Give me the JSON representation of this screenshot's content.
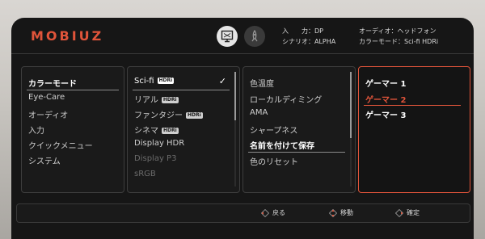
{
  "header": {
    "logo": "MOBIUZ",
    "info": {
      "input_label": "入　　力：",
      "input_value": "DP",
      "scenario_label": "シナリオ：",
      "scenario_value": "ALPHA",
      "audio_label": "オーディオ：",
      "audio_value": "ヘッドフォン",
      "color_mode_label": "カラーモード：",
      "color_mode_value": "Sci-fi HDRi"
    }
  },
  "menu_main": {
    "title": "カラーモード",
    "items": [
      "Eye-Care",
      "オーディオ",
      "入力",
      "クイックメニュー",
      "システム"
    ]
  },
  "menu_color_modes": {
    "items": [
      {
        "label": "Sci-fi",
        "badge": "HDRi",
        "checked": true
      },
      {
        "label": "リアル",
        "badge": "HDRi"
      },
      {
        "label": "ファンタジー",
        "badge": "HDRi"
      },
      {
        "label": "シネマ",
        "badge": "HDRi"
      },
      {
        "label": "Display HDR"
      },
      {
        "label": "Display P3",
        "disabled": true
      },
      {
        "label": "sRGB",
        "disabled": true
      }
    ],
    "check": "✓"
  },
  "menu_settings": {
    "items": [
      "色温度",
      "ローカルディミング",
      "AMA",
      "シャープネス"
    ],
    "save_label": "名前を付けて保存",
    "reset_label": "色のリセット"
  },
  "menu_gamer": {
    "items": [
      "ゲーマー 1",
      "ゲーマー 2",
      "ゲーマー 3"
    ],
    "selected_index": 1
  },
  "footer": {
    "back": "戻る",
    "move": "移動",
    "confirm": "確定"
  },
  "colors": {
    "accent": "#e0543a",
    "background": "#161616",
    "text": "#cfcfcf"
  }
}
